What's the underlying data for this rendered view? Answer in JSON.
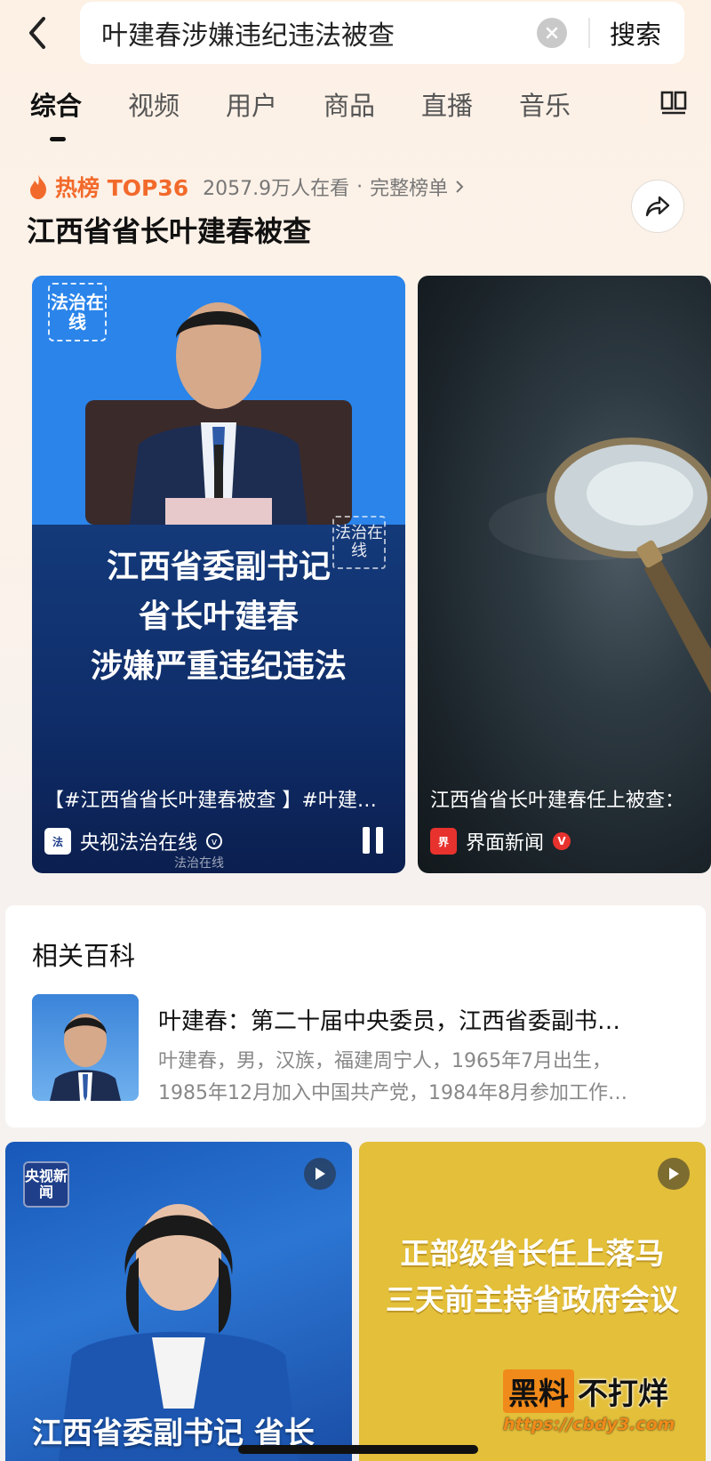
{
  "search": {
    "query": "叶建春涉嫌违纪违法被查",
    "button_label": "搜索"
  },
  "tabs": [
    {
      "label": "综合",
      "active": true
    },
    {
      "label": "视频"
    },
    {
      "label": "用户"
    },
    {
      "label": "商品"
    },
    {
      "label": "直播"
    },
    {
      "label": "音乐"
    }
  ],
  "hot": {
    "title": "热榜 TOP36",
    "viewers": "2057.9万人在看",
    "dot": "·",
    "full_list": "完整榜单",
    "topic": "江西省省长叶建春被查"
  },
  "cards": [
    {
      "logo": "法治在线",
      "overlay": [
        "江西省委副书记",
        "省长叶建春",
        "涉嫌严重违纪违法"
      ],
      "watermark": "法治在线",
      "caption": "【#江西省省长叶建春被查 】#叶建…",
      "source": "央视法治在线",
      "footer": "法治在线"
    },
    {
      "caption": "江西省省长叶建春任上被查：",
      "source": "界面新闻",
      "verified": "V"
    }
  ],
  "baike": {
    "header": "相关百科",
    "title": "叶建春：第二十届中央委员，江西省委副书…",
    "desc_line1": "叶建春，男，汉族，福建周宁人，1965年7月出生，",
    "desc_line2": "1985年12月加入中国共产党，1984年8月参加工作…"
  },
  "grid": [
    {
      "logo": "央视新闻",
      "caption": "江西省委副书记 省长"
    },
    {
      "headline": [
        "正部级省长任上落马",
        "三天前主持省政府会议"
      ]
    }
  ],
  "brand": {
    "black": "黑料",
    "rest": "不打烊",
    "url": "https://cbdy3.com"
  },
  "colors": {
    "accent": "#f26a2b",
    "card1_blue": "#1f7be0",
    "card2_bg": "#1c252b",
    "grid2_yellow": "#e3bf3a"
  }
}
